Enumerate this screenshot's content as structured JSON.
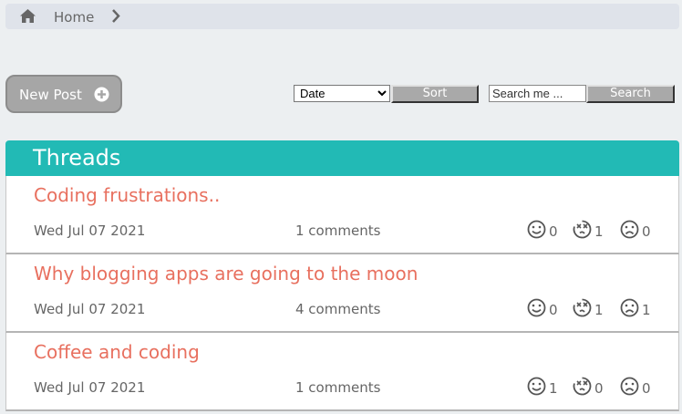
{
  "breadcrumb": {
    "home_icon": "home-icon",
    "home_label": "Home",
    "separator_icon": "chevron-right-icon"
  },
  "toolbar": {
    "new_post_label": "New Post",
    "new_post_icon": "plus-circle-icon",
    "sort_options": [
      "Date"
    ],
    "sort_selected": "Date",
    "sort_label": "Sort",
    "search_placeholder": "Search me ...",
    "search_label": "Search"
  },
  "threads": {
    "title": "Threads",
    "header_color": "#22bab5",
    "title_color": "#e8705f",
    "items": [
      {
        "title": "Coding frustrations..",
        "date": "Wed Jul 07 2021",
        "comments": "1 comments",
        "happy": "0",
        "dizzy": "1",
        "sad": "0"
      },
      {
        "title": "Why blogging apps are going to the moon",
        "date": "Wed Jul 07 2021",
        "comments": "4 comments",
        "happy": "0",
        "dizzy": "1",
        "sad": "1"
      },
      {
        "title": "Coffee and coding",
        "date": "Wed Jul 07 2021",
        "comments": "1 comments",
        "happy": "1",
        "dizzy": "0",
        "sad": "0"
      }
    ]
  }
}
